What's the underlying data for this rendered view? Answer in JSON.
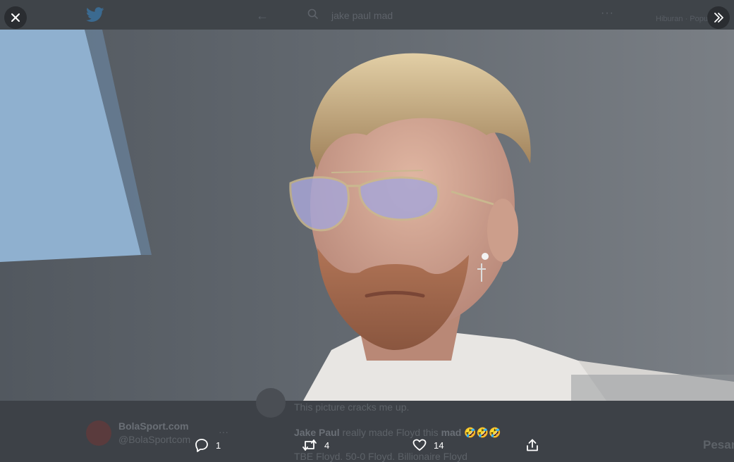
{
  "header": {
    "search_query": "jake paul mad",
    "trend_text": "Hiburan · Popular"
  },
  "photo": {
    "alt_subject": "man-with-tinted-sunglasses"
  },
  "background_tweets": {
    "reply_text": "This picture cracks me up.",
    "line2_author": "Jake Paul",
    "line2_mid": " really made Floyd this ",
    "line2_bold": "mad",
    "line2_emoji": " 🤣🤣🤣",
    "line3": "TBE Floyd. 50-0 Floyd. Billionaire Floyd",
    "account_name": "BolaSport.com",
    "account_handle": "@BolaSportcom",
    "messages_label": "Pesan"
  },
  "actions": {
    "reply_count": "1",
    "retweet_count": "4",
    "like_count": "14"
  },
  "colors": {
    "overlay_bg": "#3d4147",
    "icon_white": "#ffffff",
    "button_bg": "#2a2d31"
  }
}
